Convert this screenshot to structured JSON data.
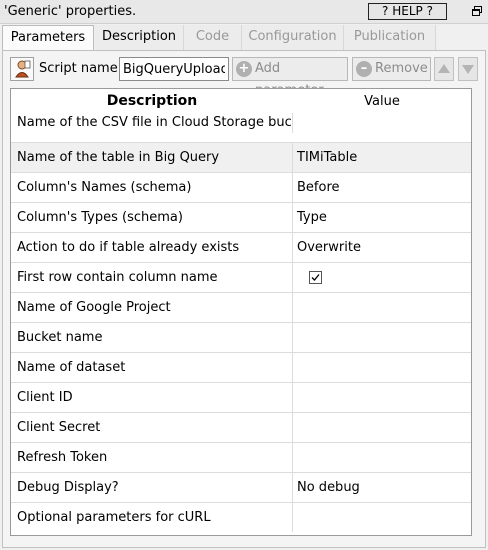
{
  "window": {
    "title": "'Generic' properties.",
    "help_label": "? HELP ?"
  },
  "tabs": [
    {
      "label": "Parameters",
      "active": true
    },
    {
      "label": "Description",
      "active": false
    },
    {
      "label": "Code",
      "active": false
    },
    {
      "label": "Configuration",
      "active": false
    },
    {
      "label": "Publication",
      "active": false
    }
  ],
  "toolbar": {
    "script_name_label": "Script name:",
    "script_name_value": "BigQueryUpload",
    "add_parameter_label": "Add parameter",
    "remove_label": "Remove"
  },
  "table": {
    "headers": {
      "description": "Description",
      "value": "Value"
    },
    "rows": [
      {
        "description": "Name of the CSV file in Cloud Storage buc…",
        "value": ""
      },
      {
        "description": "Name of the table in Big Query",
        "value": "TIMiTable"
      },
      {
        "description": "Column's Names (schema)",
        "value": "Before"
      },
      {
        "description": "Column's Types (schema)",
        "value": "Type"
      },
      {
        "description": "Action to do if table already exists",
        "value": "Overwrite"
      },
      {
        "description": "First row contain column name",
        "value": "",
        "checkbox": true,
        "checked": true
      },
      {
        "description": "Name of Google Project",
        "value": ""
      },
      {
        "description": "Bucket name",
        "value": ""
      },
      {
        "description": "Name of dataset",
        "value": ""
      },
      {
        "description": "Client ID",
        "value": ""
      },
      {
        "description": "Client Secret",
        "value": ""
      },
      {
        "description": "Refresh Token",
        "value": ""
      },
      {
        "description": "Debug Display?",
        "value": "No debug"
      },
      {
        "description": "Optional parameters for cURL",
        "value": ""
      }
    ]
  }
}
